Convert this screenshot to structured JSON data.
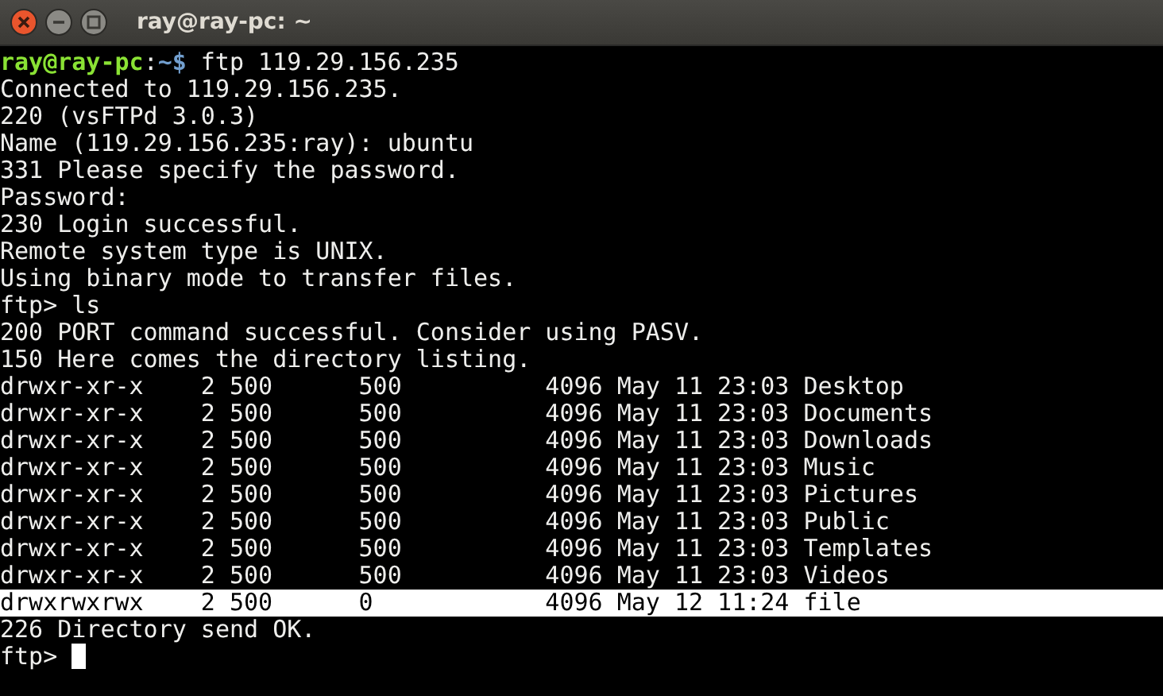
{
  "window": {
    "title": "ray@ray-pc: ~"
  },
  "lines": [
    {
      "kind": "shell_prompt",
      "user": "ray@ray-pc",
      "separator": ":",
      "path": "~",
      "symbol": "$",
      "command": "ftp 119.29.156.235"
    },
    {
      "kind": "output",
      "text": "Connected to 119.29.156.235."
    },
    {
      "kind": "output",
      "text": "220 (vsFTPd 3.0.3)"
    },
    {
      "kind": "output",
      "text": "Name (119.29.156.235:ray): ubuntu"
    },
    {
      "kind": "output",
      "text": "331 Please specify the password."
    },
    {
      "kind": "output",
      "text": "Password:"
    },
    {
      "kind": "output",
      "text": "230 Login successful."
    },
    {
      "kind": "output",
      "text": "Remote system type is UNIX."
    },
    {
      "kind": "output",
      "text": "Using binary mode to transfer files."
    },
    {
      "kind": "output",
      "text": "ftp> ls"
    },
    {
      "kind": "output",
      "text": "200 PORT command successful. Consider using PASV."
    },
    {
      "kind": "output",
      "text": "150 Here comes the directory listing."
    },
    {
      "kind": "listing",
      "text": "drwxr-xr-x    2 500      500          4096 May 11 23:03 Desktop",
      "highlighted": false
    },
    {
      "kind": "listing",
      "text": "drwxr-xr-x    2 500      500          4096 May 11 23:03 Documents",
      "highlighted": false
    },
    {
      "kind": "listing",
      "text": "drwxr-xr-x    2 500      500          4096 May 11 23:03 Downloads",
      "highlighted": false
    },
    {
      "kind": "listing",
      "text": "drwxr-xr-x    2 500      500          4096 May 11 23:03 Music",
      "highlighted": false
    },
    {
      "kind": "listing",
      "text": "drwxr-xr-x    2 500      500          4096 May 11 23:03 Pictures",
      "highlighted": false
    },
    {
      "kind": "listing",
      "text": "drwxr-xr-x    2 500      500          4096 May 11 23:03 Public",
      "highlighted": false
    },
    {
      "kind": "listing",
      "text": "drwxr-xr-x    2 500      500          4096 May 11 23:03 Templates",
      "highlighted": false
    },
    {
      "kind": "listing",
      "text": "drwxr-xr-x    2 500      500          4096 May 11 23:03 Videos",
      "highlighted": false
    },
    {
      "kind": "listing",
      "text": "drwxrwxrwx    2 500      0            4096 May 12 11:24 file",
      "highlighted": true
    },
    {
      "kind": "output",
      "text": "226 Directory send OK."
    },
    {
      "kind": "input_prompt",
      "text": "ftp>",
      "cursor": true
    }
  ]
}
